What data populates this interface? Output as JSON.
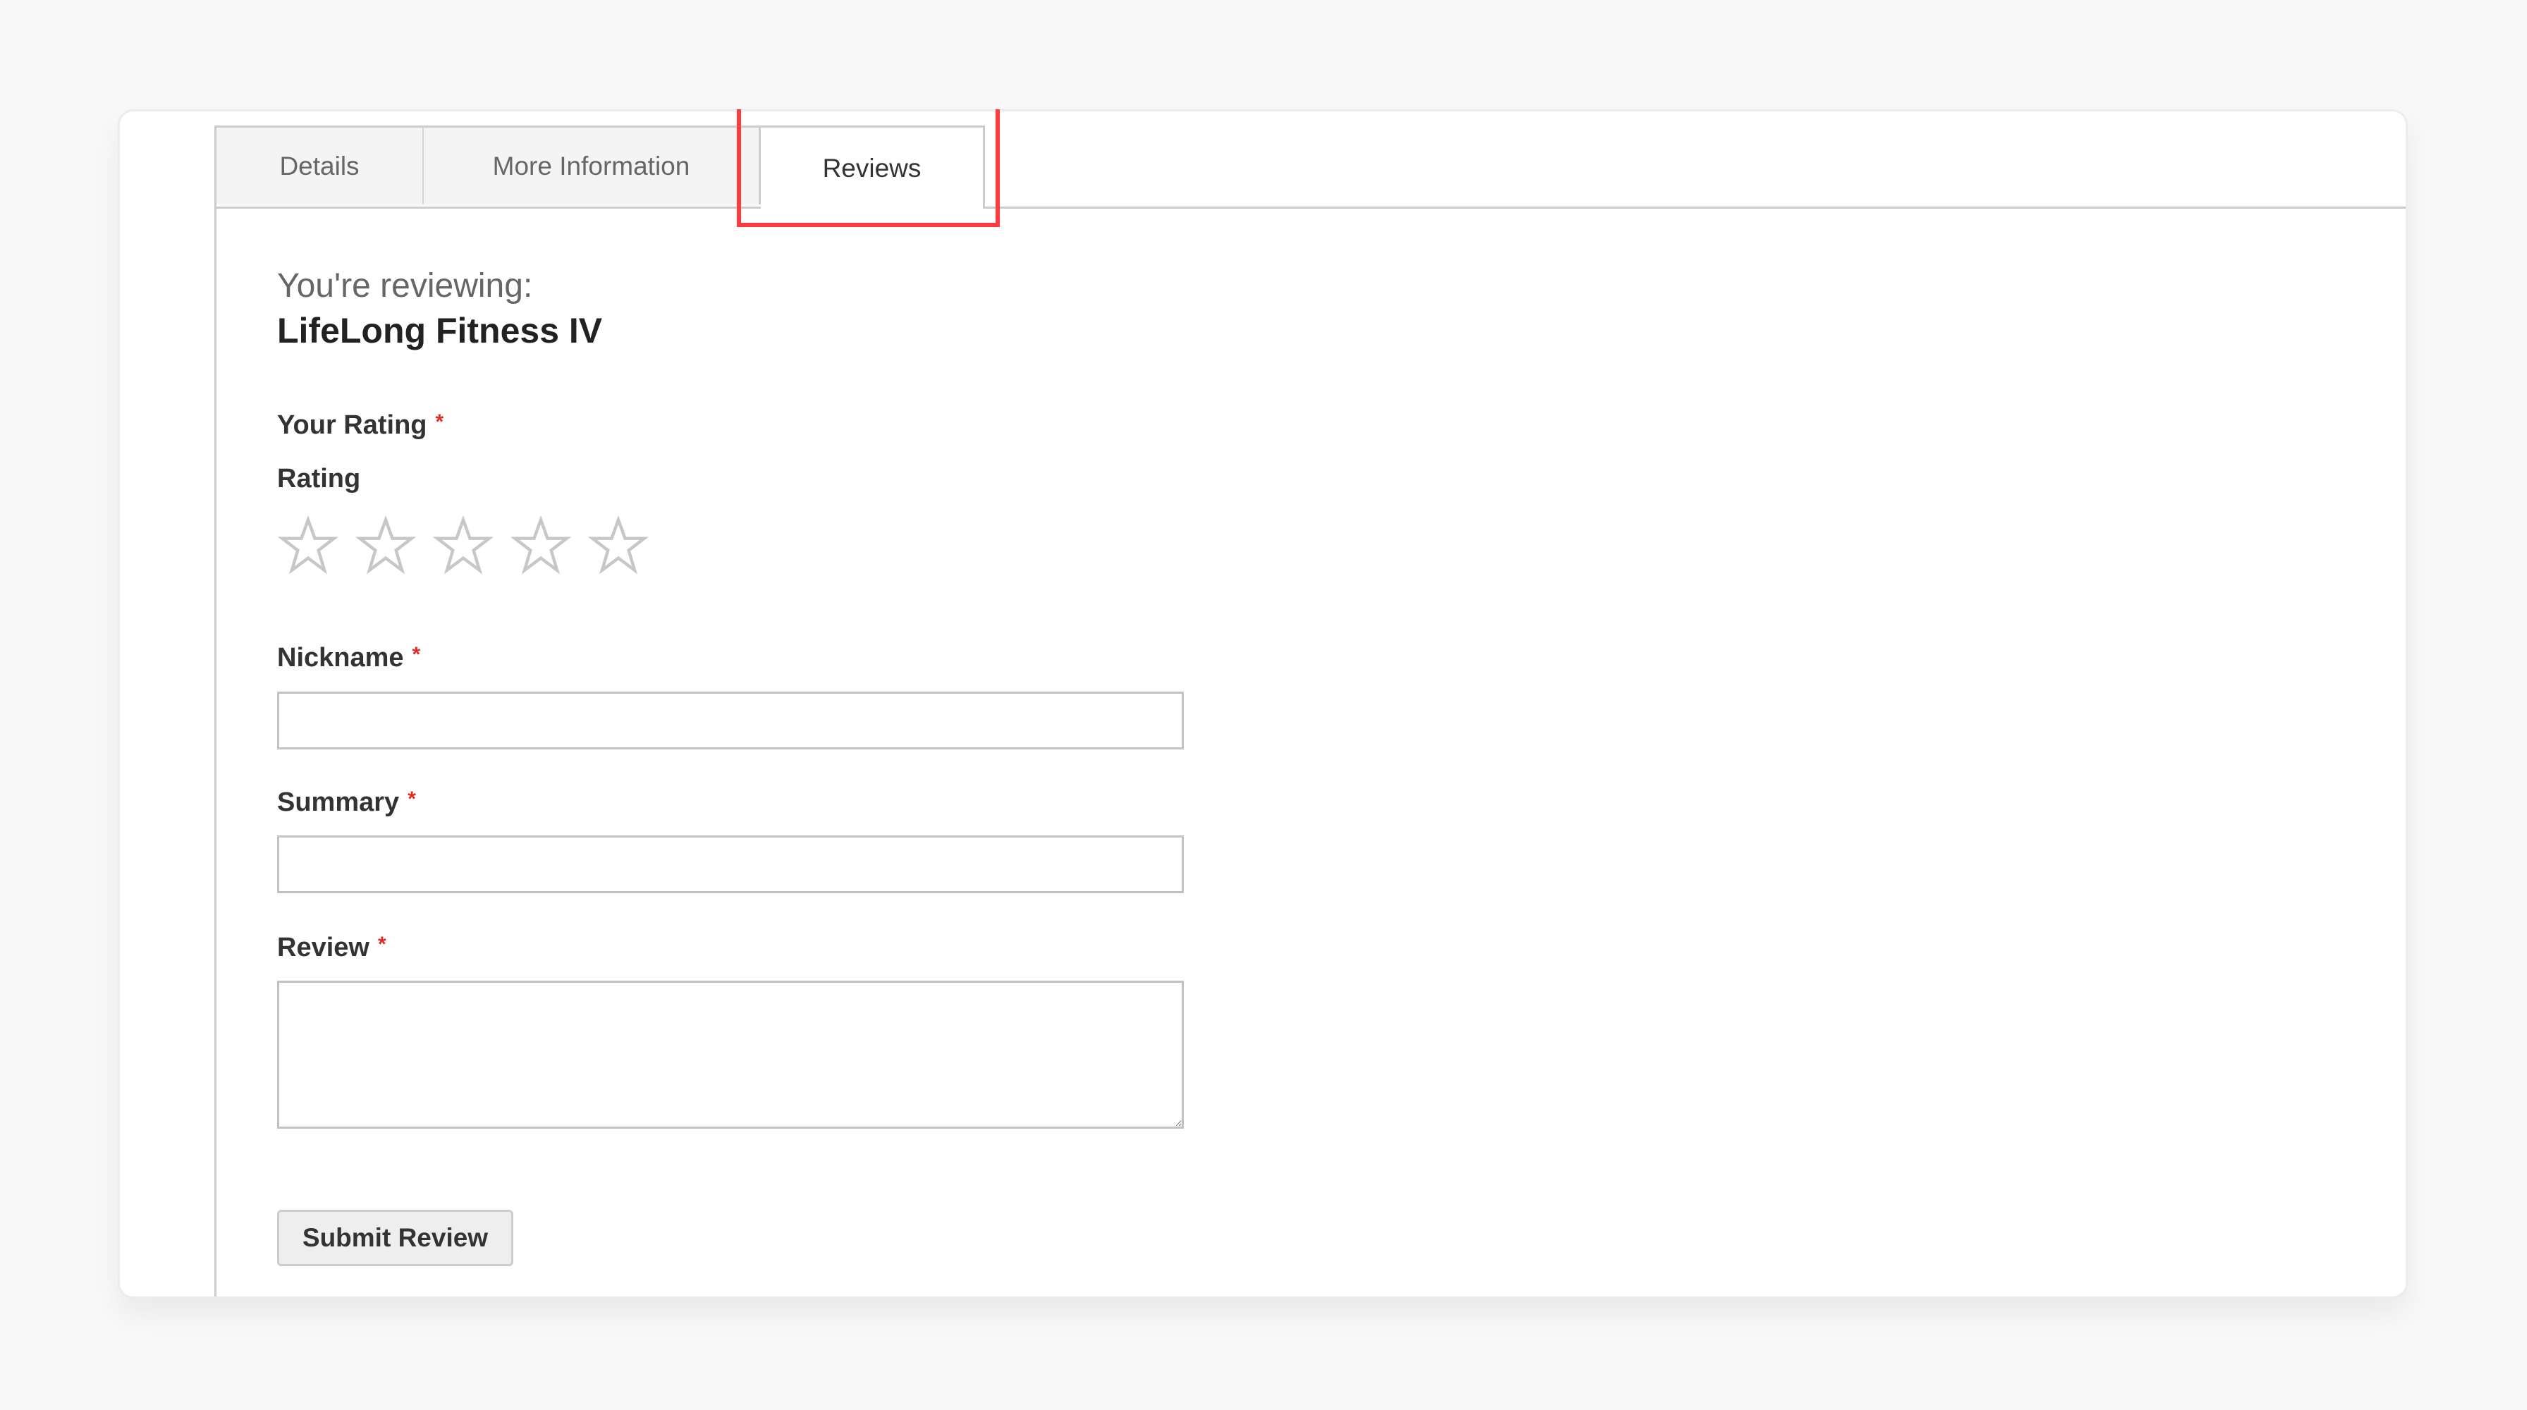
{
  "tabs": [
    {
      "label": "Details",
      "active": false
    },
    {
      "label": "More Information",
      "active": false
    },
    {
      "label": "Reviews",
      "active": true
    }
  ],
  "highlight_color": "#ff3b3f",
  "review_form": {
    "reviewing_label": "You're reviewing:",
    "product_name": "LifeLong Fitness IV",
    "your_rating_label": "Your Rating",
    "required_marker": "*",
    "rating_label": "Rating",
    "rating": {
      "selected": 0,
      "max": 5
    },
    "nickname": {
      "label": "Nickname",
      "value": "",
      "placeholder": ""
    },
    "summary": {
      "label": "Summary",
      "value": "",
      "placeholder": ""
    },
    "review": {
      "label": "Review",
      "value": "",
      "placeholder": ""
    },
    "submit_label": "Submit Review"
  },
  "icons": {
    "star": "star-outline-icon",
    "resize": "resize-handle-icon"
  },
  "colors": {
    "required": "#e02b27",
    "star_empty": "#c7c7c7",
    "tab_inactive_bg": "#f4f4f4",
    "border": "#cccccc"
  }
}
